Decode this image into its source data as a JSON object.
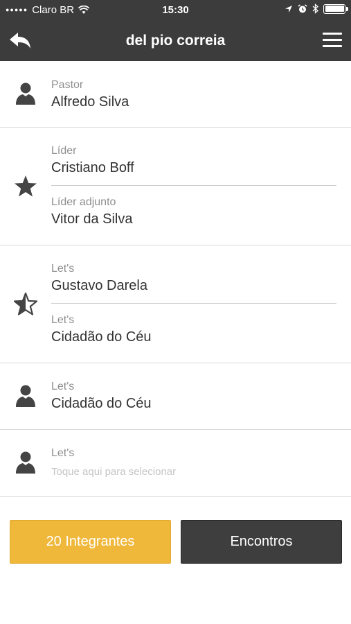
{
  "status_bar": {
    "carrier": "Claro BR",
    "time": "15:30"
  },
  "nav": {
    "title": "del pio correia"
  },
  "sections": [
    {
      "icon": "person-icon",
      "entries": [
        {
          "label": "Pastor",
          "value": "Alfredo Silva"
        }
      ]
    },
    {
      "icon": "star-icon",
      "entries": [
        {
          "label": "Líder",
          "value": "Cristiano Boff"
        },
        {
          "label": "Líder adjunto",
          "value": "Vitor da Silva"
        }
      ]
    },
    {
      "icon": "half-star-icon",
      "entries": [
        {
          "label": "Let's",
          "value": "Gustavo Darela"
        },
        {
          "label": "Let's",
          "value": "Cidadão do Céu"
        }
      ]
    },
    {
      "icon": "person-icon",
      "entries": [
        {
          "label": "Let's",
          "value": "Cidadão do Céu"
        }
      ]
    },
    {
      "icon": "person-icon",
      "entries": [
        {
          "label": "Let's",
          "placeholder": "Toque aqui para selecionar"
        }
      ]
    }
  ],
  "buttons": {
    "members": "20 Integrantes",
    "meetings": "Encontros"
  },
  "colors": {
    "bar": "#3c3c3c",
    "accent": "#f0b83a",
    "dark_button": "#3e3e3e"
  }
}
